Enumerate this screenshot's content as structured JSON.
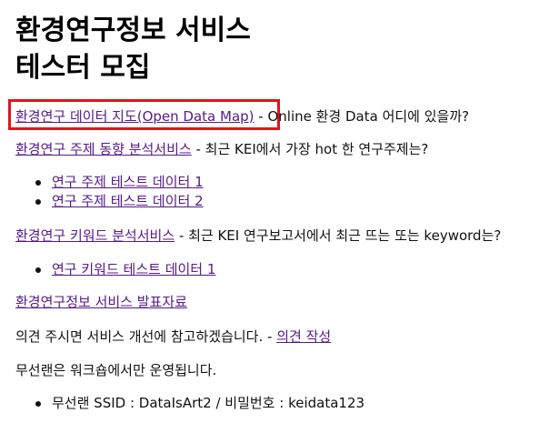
{
  "title": {
    "line1": "환경연구정보 서비스",
    "line2": "테스터 모집"
  },
  "sections": {
    "map": {
      "link": "환경연구 데이터 지도(Open Data Map)",
      "desc": " - Online 환경 Data 어디에 있을까?"
    },
    "topic": {
      "link": "환경연구 주제 동향 분석서비스",
      "desc": " - 최근 KEI에서 가장 hot 한 연구주제는?",
      "items": [
        "연구 주제 테스트 데이터 1",
        "연구 주제 테스트 데이터 2"
      ]
    },
    "keyword": {
      "link": "환경연구 키워드 분석서비스",
      "desc": " - 최근 KEI 연구보고서에서 최근 뜨는 또는 keyword는?",
      "items": [
        "연구 키워드 테스트 데이터 1"
      ]
    },
    "presentation": {
      "link": "환경연구정보 서비스 발표자료"
    },
    "feedback": {
      "text": "의견 주시면 서비스 개선에 참고하겠습니다. - ",
      "link": "의견 작성"
    },
    "wifi": {
      "text": "무선랜은 워크숍에서만 운영됩니다.",
      "items": [
        "무선랜 SSID : DataIsArt2 / 비밀번호 : keidata123"
      ]
    }
  },
  "colors": {
    "link": "#551a8b",
    "highlight_border": "#e0141e",
    "text": "#111111"
  }
}
